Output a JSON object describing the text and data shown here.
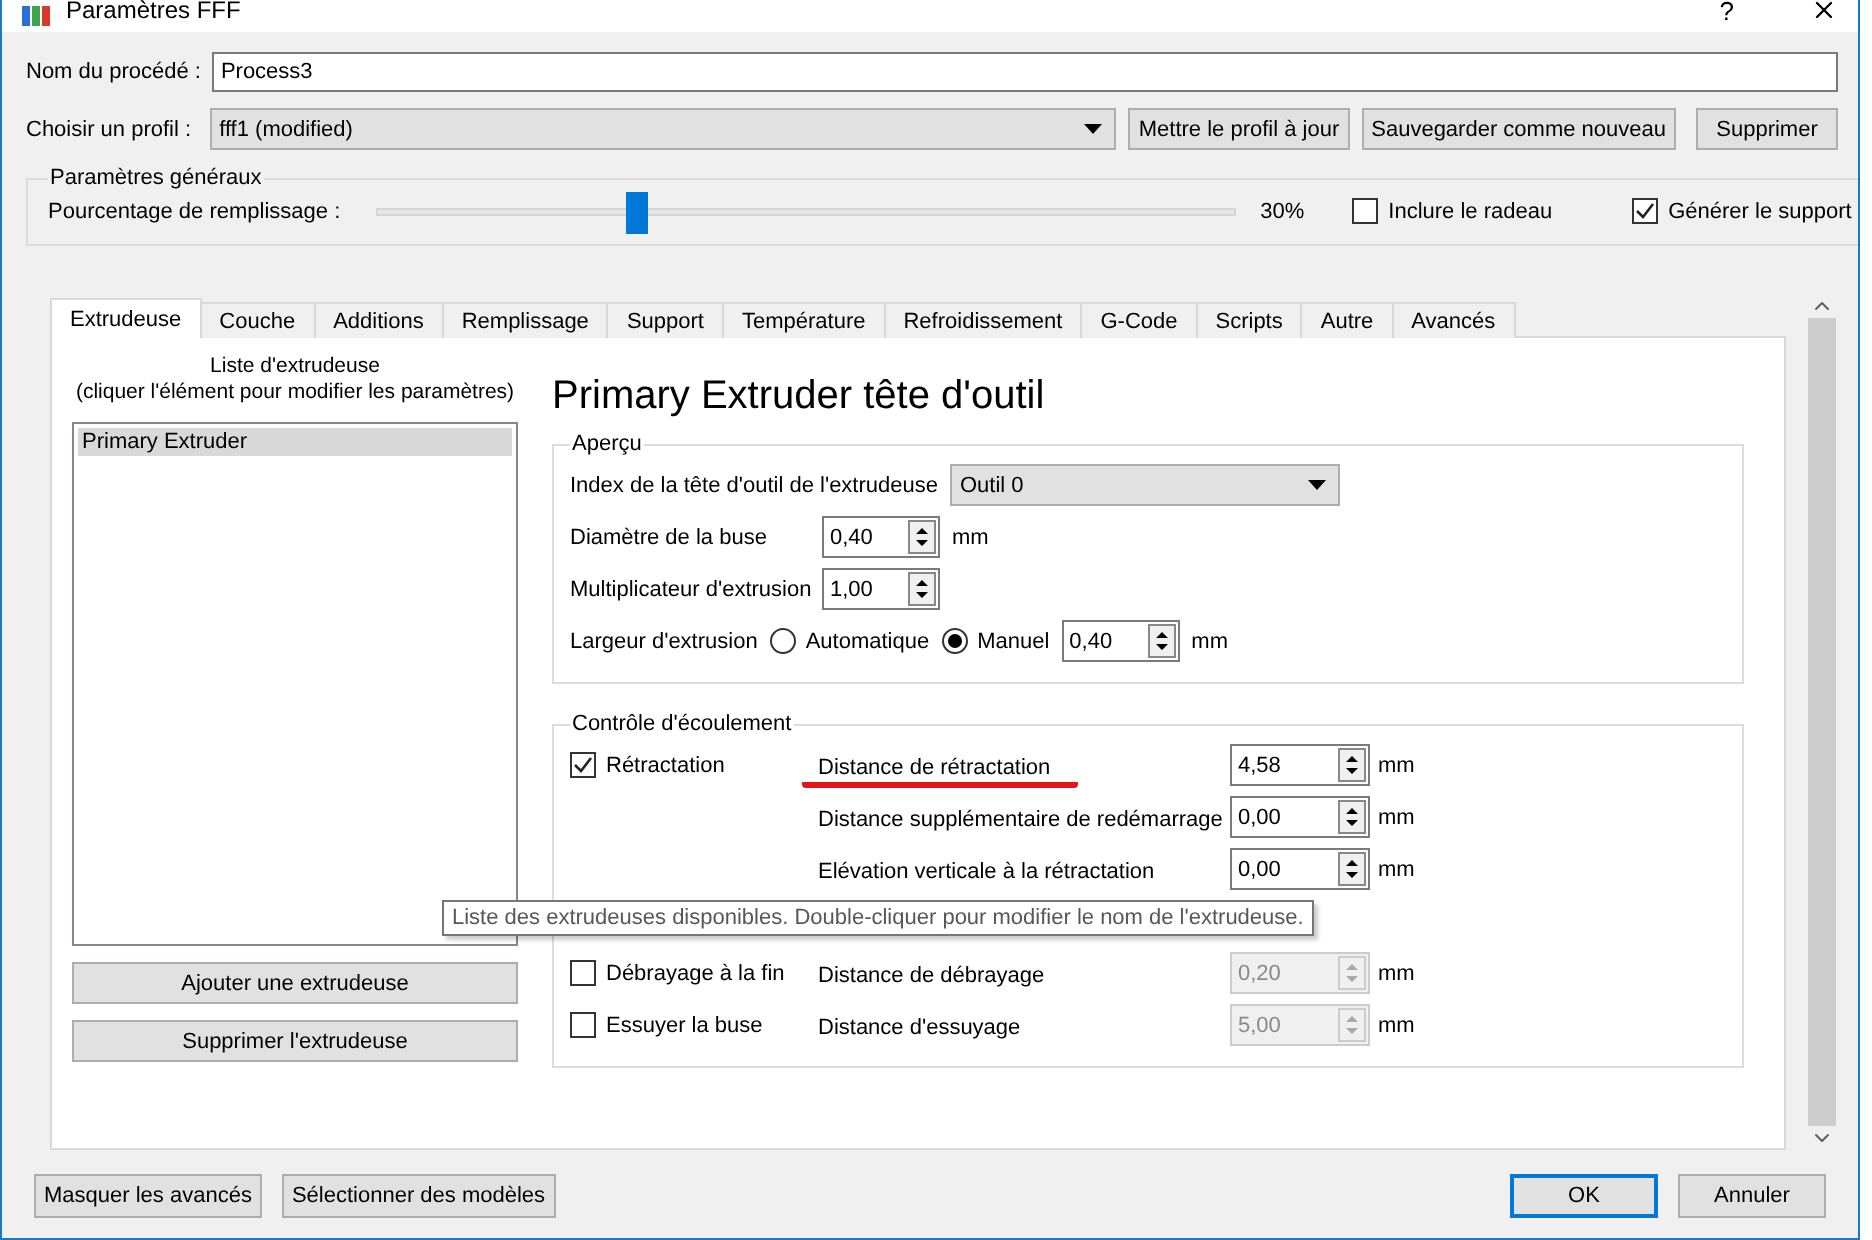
{
  "window": {
    "title": "Paramètres FFF",
    "help": "?"
  },
  "process_name": {
    "label": "Nom du procédé :",
    "value": "Process3"
  },
  "profile": {
    "label": "Choisir un profil :",
    "value": "fff1 (modified)",
    "buttons": [
      "Mettre le profil à jour",
      "Sauvegarder comme nouveau",
      "Supprimer"
    ]
  },
  "general": {
    "title": "Paramètres généraux",
    "infill": {
      "label": "Pourcentage de remplissage :",
      "level": 0.3,
      "reading": "30%"
    },
    "checkboxes": [
      {
        "label": "Inclure le radeau",
        "checked": false
      },
      {
        "label": "Générer le support",
        "checked": true
      }
    ]
  },
  "tabs": [
    {
      "label": "Extrudeuse",
      "selected": true
    },
    {
      "label": "Couche",
      "selected": false
    },
    {
      "label": "Additions",
      "selected": false
    },
    {
      "label": "Remplissage",
      "selected": false
    },
    {
      "label": "Support",
      "selected": false
    },
    {
      "label": "Température",
      "selected": false
    },
    {
      "label": "Refroidissement",
      "selected": false
    },
    {
      "label": "G-Code",
      "selected": false
    },
    {
      "label": "Scripts",
      "selected": false
    },
    {
      "label": "Autre",
      "selected": false
    },
    {
      "label": "Avancés",
      "selected": false
    }
  ],
  "extruder_list": {
    "caption": "Liste d'extrudeuse",
    "hint": "(cliquer l'élément pour modifier les paramètres)",
    "items": [
      {
        "label": "Primary Extruder",
        "selected": true
      }
    ],
    "buttons": [
      "Ajouter une extrudeuse",
      "Supprimer l'extrudeuse"
    ]
  },
  "heading": "Primary Extruder tête d'outil",
  "overview": {
    "title": "Aperçu",
    "rows": [
      {
        "kind": "select",
        "label": "Index de la tête d'outil de l'extrudeuse",
        "value": "Outil 0"
      },
      {
        "kind": "spin",
        "label": "Diamètre de la buse",
        "value": "0,40",
        "unit": "mm"
      },
      {
        "kind": "spin",
        "label": "Multiplicateur d'extrusion",
        "value": "1,00"
      },
      {
        "kind": "radio",
        "label": "Largeur d'extrusion",
        "options": [
          {
            "label": "Automatique",
            "selected": false
          },
          {
            "label": "Manuel",
            "selected": true
          }
        ],
        "value": "0,40",
        "unit": "mm"
      }
    ]
  },
  "flow": {
    "title": "Contrôle d'écoulement",
    "rows": [
      {
        "kind": "field",
        "check": {
          "label": "Rétractation",
          "checked": true
        },
        "label": "Distance de rétractation",
        "value": "4,58",
        "unit": "mm",
        "disabled": false,
        "underlined": true
      },
      {
        "kind": "field",
        "label": "Distance supplémentaire de redémarrage",
        "value": "0,00",
        "unit": "mm",
        "disabled": false,
        "underlined": false
      },
      {
        "kind": "field",
        "label": "Elévation verticale à la rétractation",
        "value": "0,00",
        "unit": "mm",
        "disabled": false,
        "underlined": false
      },
      {
        "kind": "covered"
      },
      {
        "kind": "field",
        "check": {
          "label": "Débrayage à la fin",
          "checked": false
        },
        "label": "Distance de débrayage",
        "value": "0,20",
        "unit": "mm",
        "disabled": true,
        "underlined": false
      },
      {
        "kind": "field",
        "check": {
          "label": "Essuyer la buse",
          "checked": false
        },
        "label": "Distance d'essuyage",
        "value": "5,00",
        "unit": "mm",
        "disabled": true,
        "underlined": false
      }
    ]
  },
  "tooltip": "Liste des extrudeuses disponibles. Double-cliquer pour modifier le nom de l'extrudeuse.",
  "footer": {
    "left_buttons": [
      "Masquer les avancés",
      "Sélectionner des modèles"
    ],
    "ok": "OK",
    "cancel": "Annuler"
  }
}
